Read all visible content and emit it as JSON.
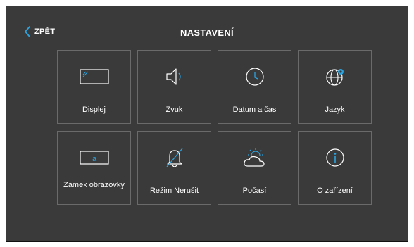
{
  "header": {
    "back_label": "ZPĚT",
    "title": "NASTAVENÍ"
  },
  "tiles": [
    {
      "label": "Displej",
      "icon": "display-icon"
    },
    {
      "label": "Zvuk",
      "icon": "speaker-icon"
    },
    {
      "label": "Datum a čas",
      "icon": "clock-icon"
    },
    {
      "label": "Jazyk",
      "icon": "globe-icon"
    },
    {
      "label": "Zámek obrazovky",
      "icon": "screen-lock-icon"
    },
    {
      "label": "Režim Nerušit",
      "icon": "bell-off-icon"
    },
    {
      "label": "Počasí",
      "icon": "weather-icon"
    },
    {
      "label": "O zařízení",
      "icon": "info-icon"
    }
  ],
  "colors": {
    "accent": "#2ba3e0",
    "background": "#3a3a3a",
    "tile_border": "#6a6a6a",
    "text": "#ffffff"
  }
}
